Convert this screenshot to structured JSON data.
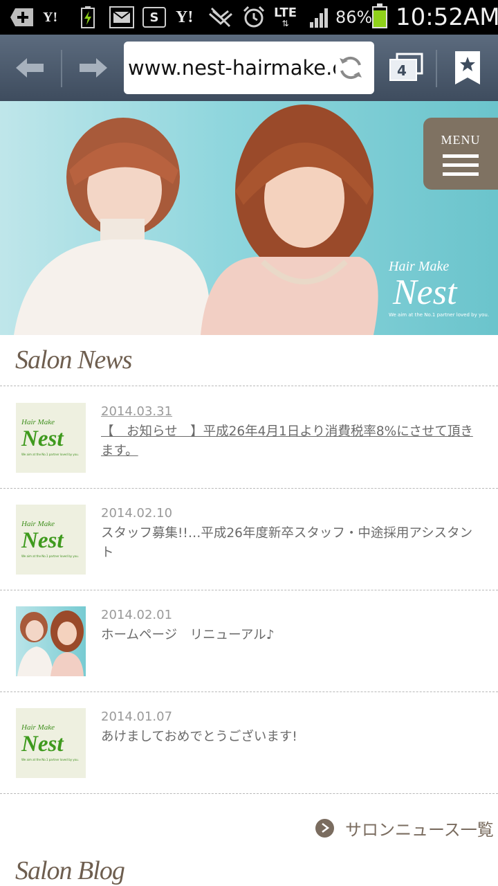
{
  "status_bar": {
    "icons": [
      "add-notification-icon",
      "yahoo-mail-icon",
      "charging-icon",
      "mail-icon",
      "s-app-icon",
      "yahoo-icon",
      "no-signal-icon",
      "alarm-icon",
      "lte-icon",
      "signal-icon"
    ],
    "network": "LTE",
    "yahoo_label": "Y!",
    "battery_percent": "86%",
    "battery_level": 0.86,
    "time": "10:52AM",
    "battery_color": "#8fd11a"
  },
  "browser": {
    "url": "www.nest-hairmake.c",
    "tab_count": "4"
  },
  "hero": {
    "menu_label": "MENU",
    "brand_small": "Hair Make",
    "brand_big": "Nest",
    "brand_tagline": "We aim at the No.1 partner loved by you."
  },
  "salon_news": {
    "heading": "Salon News",
    "items": [
      {
        "date": "2014.03.31",
        "title": "【　お知らせ　】平成26年4月1日より消費税率8%にさせて頂きます。",
        "thumb": "logo"
      },
      {
        "date": "2014.02.10",
        "title": "スタッフ募集!!…平成26年度新卒スタッフ・中途採用アシスタント",
        "thumb": "logo"
      },
      {
        "date": "2014.02.01",
        "title": "ホームページ　リニューアル♪",
        "thumb": "photo"
      },
      {
        "date": "2014.01.07",
        "title": "あけましておめでとうございます!",
        "thumb": "logo"
      }
    ],
    "more_link": "サロンニュース一覧"
  },
  "salon_blog": {
    "heading": "Salon Blog"
  },
  "colors": {
    "accent_brown": "#7f7262",
    "logo_green": "#3f9a1e",
    "hero_teal": "#8fd6dd"
  }
}
